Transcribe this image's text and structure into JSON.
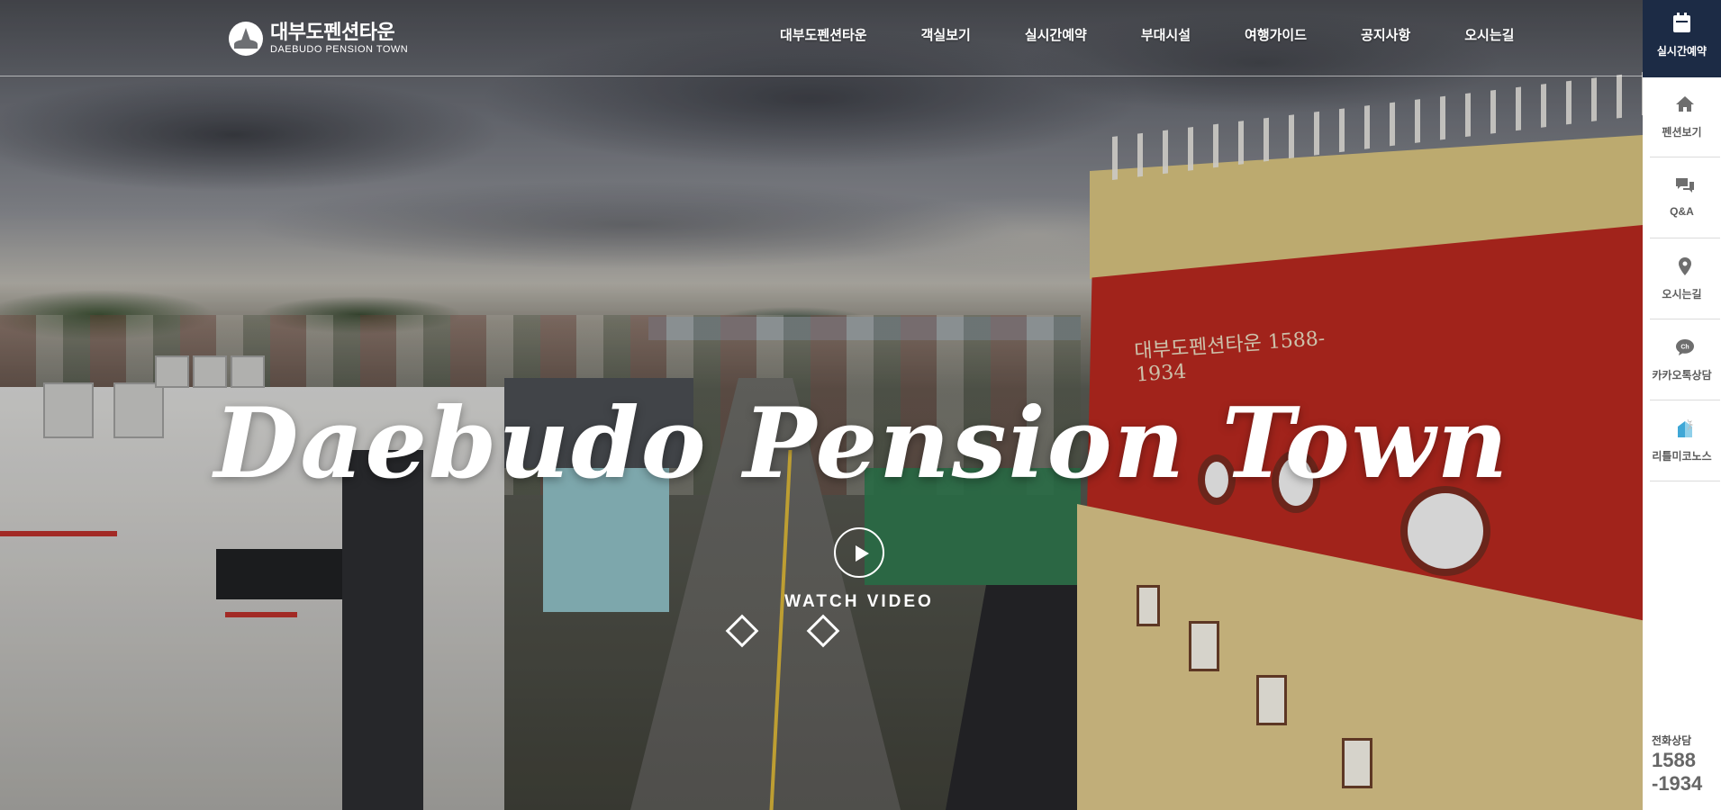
{
  "brand": {
    "name_ko": "대부도펜션타운",
    "name_en": "DAEBUDO PENSION TOWN"
  },
  "nav": {
    "items": [
      {
        "label": "대부도펜션타운"
      },
      {
        "label": "객실보기"
      },
      {
        "label": "실시간예약"
      },
      {
        "label": "부대시설"
      },
      {
        "label": "여행가이드"
      },
      {
        "label": "공지사항"
      },
      {
        "label": "오시는길"
      }
    ]
  },
  "hero": {
    "title": "Daebudo Pension Town",
    "video_label": "WATCH VIDEO",
    "slides_count": "2",
    "sign_text": "대부도펜션타운 1588-1934"
  },
  "quickmenu": {
    "top_label": "실시간예약",
    "items": [
      {
        "label": "펜션보기",
        "icon": "home-icon"
      },
      {
        "label": "Q&A",
        "icon": "chat-bubbles-icon"
      },
      {
        "label": "오시는길",
        "icon": "map-pin-icon"
      },
      {
        "label": "카카오톡상담",
        "icon": "kakaotalk-icon"
      },
      {
        "label": "리틀미코노스",
        "icon": "little-mykonos-icon"
      }
    ],
    "tel_label": "전화상담",
    "tel_number": "1588 -1934"
  },
  "colors": {
    "quickmenu_top_bg": "#1c2b45",
    "icon_gray": "#6e6e6e",
    "kakao": "#6e6e6e",
    "building_red": "#b8281f"
  }
}
